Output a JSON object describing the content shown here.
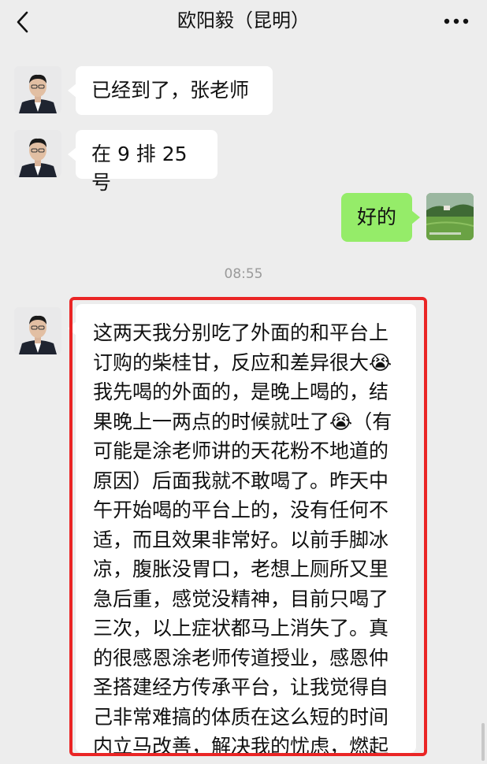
{
  "header": {
    "title": "欧阳毅（昆明）",
    "back_icon": "chevron-left-icon",
    "more_icon": "more-dots-icon"
  },
  "messages": [
    {
      "sender": "contact",
      "text": "已经到了，张老师"
    },
    {
      "sender": "contact",
      "text": "在 9 排 25 号"
    },
    {
      "sender": "me",
      "text": "好的"
    }
  ],
  "timestamp": "08:55",
  "long_message": {
    "sender": "contact",
    "text": "这两天我分别吃了外面的和平台上订购的柴桂甘，反应和差异很大😭我先喝的外面的，是晚上喝的，结果晚上一两点的时候就吐了😭（有可能是涂老师讲的天花粉不地道的原因）后面我就不敢喝了。昨天中午开始喝的平台上的，没有任何不适，而且效果非常好。以前手脚冰凉，腹胀没胃口，老想上厕所又里急后重，感觉没精神，目前只喝了三次，以上症状都马上消失了。真的很感恩涂老师传道授业，感恩仲圣搭建经方传承平台，让我觉得自己非常难搞的体质在这么短的时间内立马改善，解决我的忧虑，燃起我的信心。🙏🙏🙏✊✊✊"
  },
  "colors": {
    "background": "#ededed",
    "bubble_received": "#ffffff",
    "bubble_sent": "#95ec69",
    "highlight_border": "#ea2525"
  }
}
